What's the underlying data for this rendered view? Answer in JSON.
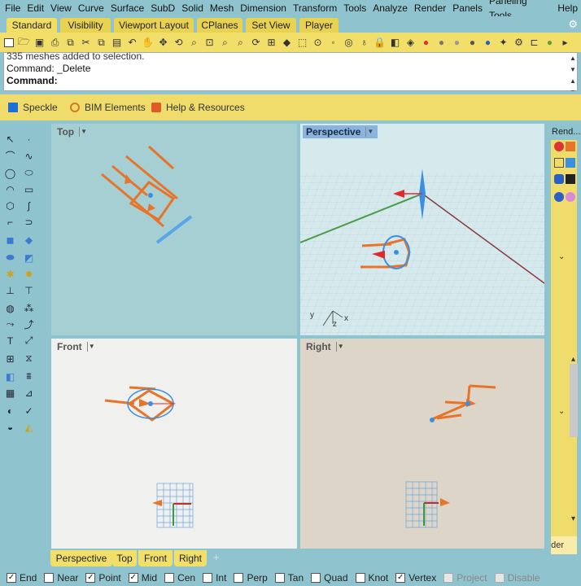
{
  "menu": [
    "File",
    "Edit",
    "View",
    "Curve",
    "Surface",
    "SubD",
    "Solid",
    "Mesh",
    "Dimension",
    "Transform",
    "Tools",
    "Analyze",
    "Render",
    "Panels",
    "Paneling Tools",
    "Help"
  ],
  "tabs": [
    {
      "label": "Standard",
      "active": true
    },
    {
      "label": "Visibility"
    },
    {
      "label": "Viewport Layout"
    },
    {
      "label": "CPlanes"
    },
    {
      "label": "Set View"
    },
    {
      "label": "Player"
    }
  ],
  "command": {
    "history_line1": "335 meshes added to selection.",
    "history_line2": "Command: _Delete",
    "prompt": "Command:"
  },
  "plugins": [
    {
      "label": "Speckle",
      "icon": "speckle-icon",
      "color": "#1e6fd9"
    },
    {
      "label": "BIM Elements",
      "icon": "bim-icon",
      "color": "#d07a2a"
    },
    {
      "label": "Help & Resources",
      "icon": "help-resources-icon",
      "color": "#e05a2a"
    }
  ],
  "viewports": {
    "top": {
      "title": "Top"
    },
    "perspective": {
      "title": "Perspective",
      "active": true,
      "axis_x": "x",
      "axis_y": "y",
      "axis_z": "z"
    },
    "front": {
      "title": "Front"
    },
    "right": {
      "title": "Right"
    }
  },
  "right_panel": {
    "title": "Rend...",
    "footer": "nder"
  },
  "viewport_tabs": [
    "Perspective",
    "Top",
    "Front",
    "Right"
  ],
  "osnaps": [
    {
      "label": "End",
      "checked": true
    },
    {
      "label": "Near",
      "checked": false
    },
    {
      "label": "Point",
      "checked": true
    },
    {
      "label": "Mid",
      "checked": true
    },
    {
      "label": "Cen",
      "checked": false
    },
    {
      "label": "Int",
      "checked": false
    },
    {
      "label": "Perp",
      "checked": false
    },
    {
      "label": "Tan",
      "checked": false
    },
    {
      "label": "Quad",
      "checked": false
    },
    {
      "label": "Knot",
      "checked": false
    },
    {
      "label": "Vertex",
      "checked": true
    },
    {
      "label": "Project",
      "checked": false,
      "disabled": true
    },
    {
      "label": "Disable",
      "checked": false,
      "disabled": true
    }
  ],
  "colors": {
    "accent_yellow": "#f2df6a",
    "frame_teal": "#8fc4cf",
    "active_viewport": "#8ab4de",
    "object_orange": "#e8742a",
    "gumball_blue": "#3b8fe0"
  }
}
